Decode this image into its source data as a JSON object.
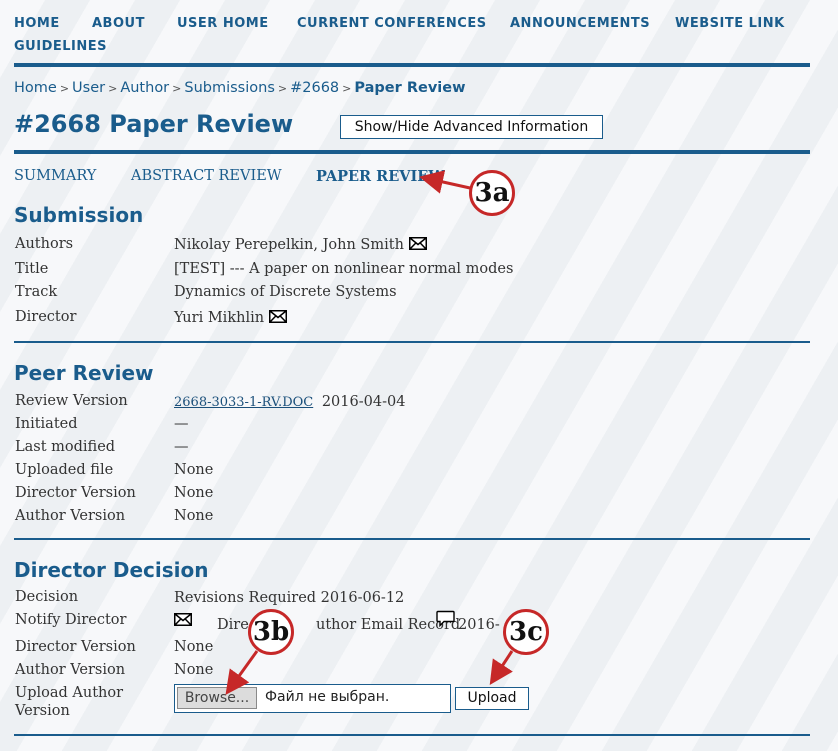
{
  "nav": {
    "home": "HOME",
    "about": "ABOUT",
    "user_home": "USER HOME",
    "current_conferences": "CURRENT CONFERENCES",
    "announcements": "ANNOUNCEMENTS",
    "website_link": "WEBSITE LINK",
    "guidelines": "GUIDELINES"
  },
  "breadcrumb": {
    "items": [
      "Home",
      "User",
      "Author",
      "Submissions",
      "#2668"
    ],
    "current": "Paper Review",
    "separator": ">"
  },
  "page": {
    "title": "#2668 Paper Review",
    "advanced_button": "Show/Hide Advanced Information"
  },
  "tabs": {
    "summary": "SUMMARY",
    "abstract_review": "ABSTRACT REVIEW",
    "paper_review": "PAPER REVIEW",
    "active": "paper_review"
  },
  "submission": {
    "heading": "Submission",
    "authors_label": "Authors",
    "authors_value": "Nikolay Perepelkin, John Smith",
    "title_label": "Title",
    "title_value": "[TEST] --- A paper on nonlinear normal modes",
    "track_label": "Track",
    "track_value": "Dynamics of Discrete Systems",
    "director_label": "Director",
    "director_value": "Yuri Mikhlin"
  },
  "peer_review": {
    "heading": "Peer Review",
    "review_version_label": "Review Version",
    "review_version_file": "2668-3033-1-RV.DOC",
    "review_version_date": "2016-04-04",
    "initiated_label": "Initiated",
    "initiated_value": "—",
    "last_modified_label": "Last modified",
    "last_modified_value": "—",
    "uploaded_file_label": "Uploaded file",
    "uploaded_file_value": "None",
    "director_version_label": "Director Version",
    "director_version_value": "None",
    "author_version_label": "Author Version",
    "author_version_value": "None"
  },
  "director_decision": {
    "heading": "Director Decision",
    "decision_label": "Decision",
    "decision_value": "Revisions Required 2016-06-12",
    "notify_label": "Notify Director",
    "email_record_left": "Dire",
    "email_record_right": "uthor Email Record",
    "email_record_date": "2016-",
    "director_version_label": "Director Version",
    "director_version_value": "None",
    "author_version_label": "Author Version",
    "author_version_value": "None",
    "upload_label_line1": "Upload Author",
    "upload_label_line2": "Version",
    "browse_label": "Browse...",
    "no_file_text": "Файл не выбран.",
    "upload_button": "Upload"
  },
  "callouts": {
    "a": "3a",
    "b": "3b",
    "c": "3c"
  },
  "colors": {
    "primary": "#1a5c8c",
    "callout_red": "#c62828"
  }
}
